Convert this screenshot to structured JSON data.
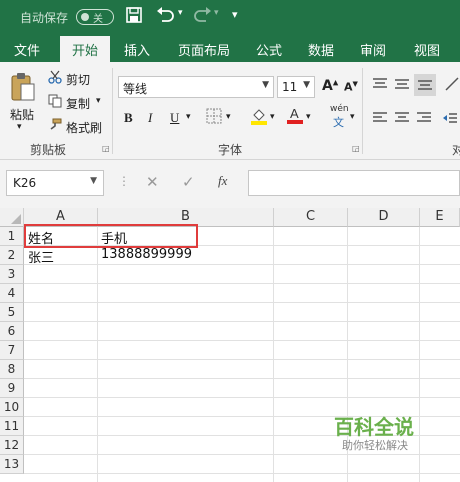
{
  "titlebar": {
    "autosave": "自动保存",
    "toggle_state": "关"
  },
  "tabs": [
    "文件",
    "开始",
    "插入",
    "页面布局",
    "公式",
    "数据",
    "审阅",
    "视图"
  ],
  "ribbon": {
    "paste": "粘贴",
    "cut": "剪切",
    "copy": "复制",
    "format_painter": "格式刷",
    "clipboard_group": "剪贴板",
    "font_name": "等线",
    "font_size": "11",
    "font_group": "字体",
    "bold": "B",
    "italic": "I",
    "underline": "U",
    "phonetic_top": "wén",
    "phonetic_bottom": "文",
    "align_group_partial": "对"
  },
  "formula_bar": {
    "name_box": "K26",
    "fx": "fx",
    "value": ""
  },
  "grid": {
    "columns": [
      "A",
      "B",
      "C",
      "D",
      "E"
    ],
    "rows": [
      "1",
      "2",
      "3",
      "4",
      "5",
      "6",
      "7",
      "8",
      "9",
      "10",
      "11",
      "12",
      "13"
    ],
    "cells": {
      "A1": "姓名",
      "B1": "手机",
      "A2": "张三",
      "B2": "13888899999"
    }
  },
  "watermark": {
    "title": "百科全说",
    "subtitle": "助你轻松解决"
  },
  "colors": {
    "accent": "#217346",
    "highlight": "#e03c3c"
  }
}
